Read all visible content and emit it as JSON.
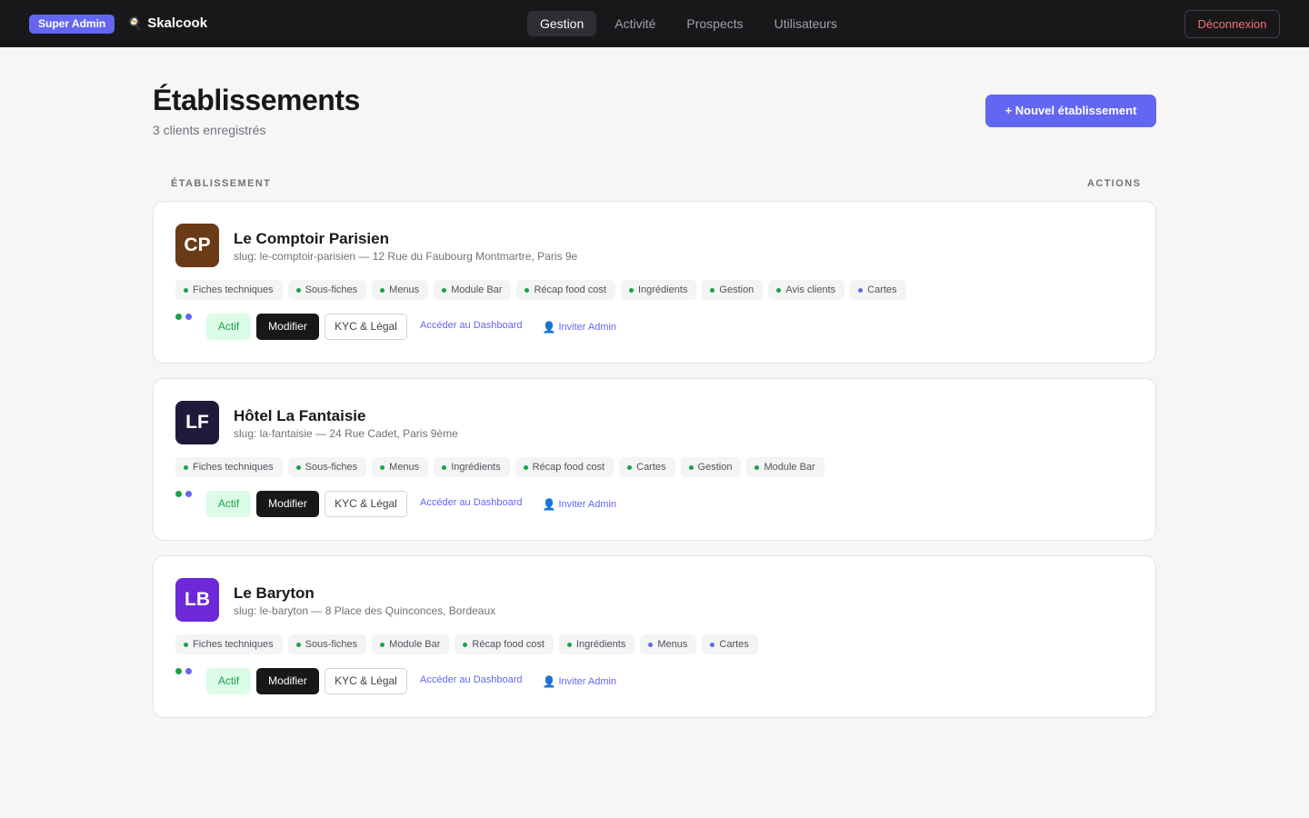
{
  "topbar": {
    "badge": "Super Admin",
    "brand_icon": "🍳",
    "brand_name": "Skalcook",
    "nav": [
      "Gestion",
      "Activité",
      "Prospects",
      "Utilisateurs"
    ],
    "active_nav": "Gestion",
    "logout_label": "Déconnexion"
  },
  "header": {
    "title": "Établissements",
    "subtitle": "3 clients enregistrés",
    "new_button": "+ Nouvel établissement"
  },
  "columns": {
    "left": "ÉTABLISSEMENT",
    "right": "ACTIONS"
  },
  "colors": {
    "accent": "#6366f1",
    "green": "#16a34a",
    "blue": "#6366f1"
  },
  "labels": {
    "status": "Actif",
    "edit": "Modifier",
    "kyc": "KYC & Légal",
    "dashboard": "Accéder au Dashboard",
    "invite": "Inviter Admin",
    "invite_icon": "👤"
  },
  "establishments": [
    {
      "initials": "CP",
      "name": "Le Comptoir Parisien",
      "slug": "slug: le-comptoir-parisien — 12 Rue du Faubourg Montmartre, Paris 9e",
      "avatar_color": "#6b3a16",
      "tags": [
        {
          "label": "Fiches techniques",
          "color": "green"
        },
        {
          "label": "Sous-fiches",
          "color": "green"
        },
        {
          "label": "Menus",
          "color": "green"
        },
        {
          "label": "Module Bar",
          "color": "green"
        },
        {
          "label": "Récap food cost",
          "color": "green"
        },
        {
          "label": "Ingrédients",
          "color": "green"
        },
        {
          "label": "Gestion",
          "color": "green"
        },
        {
          "label": "Avis clients",
          "color": "green"
        },
        {
          "label": "Cartes",
          "color": "blue"
        }
      ]
    },
    {
      "initials": "LF",
      "name": "Hôtel La Fantaisie",
      "slug": "slug: la-fantaisie — 24 Rue Cadet, Paris 9ème",
      "avatar_color": "#1e1b3a",
      "tags": [
        {
          "label": "Fiches techniques",
          "color": "green"
        },
        {
          "label": "Sous-fiches",
          "color": "green"
        },
        {
          "label": "Menus",
          "color": "green"
        },
        {
          "label": "Ingrédients",
          "color": "green"
        },
        {
          "label": "Récap food cost",
          "color": "green"
        },
        {
          "label": "Cartes",
          "color": "green"
        },
        {
          "label": "Gestion",
          "color": "green"
        },
        {
          "label": "Module Bar",
          "color": "green"
        }
      ]
    },
    {
      "initials": "LB",
      "name": "Le Baryton",
      "slug": "slug: le-baryton — 8 Place des Quinconces, Bordeaux",
      "avatar_color": "#6d28d9",
      "tags": [
        {
          "label": "Fiches techniques",
          "color": "green"
        },
        {
          "label": "Sous-fiches",
          "color": "green"
        },
        {
          "label": "Module Bar",
          "color": "green"
        },
        {
          "label": "Récap food cost",
          "color": "green"
        },
        {
          "label": "Ingrédients",
          "color": "green"
        },
        {
          "label": "Menus",
          "color": "blue"
        },
        {
          "label": "Cartes",
          "color": "blue"
        }
      ]
    }
  ]
}
